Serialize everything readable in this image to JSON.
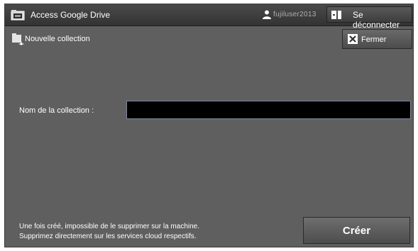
{
  "header": {
    "title": "Access Google Drive",
    "user_name": "fujiluser2013",
    "logout_label": "Se déconnecter"
  },
  "subheader": {
    "title": "Nouvelle collection",
    "close_label": "Fermer"
  },
  "form": {
    "name_label": "Nom de la collection :",
    "name_value": ""
  },
  "footer": {
    "note_line1": "Une fois créé, impossible de le supprimer sur la machine.",
    "note_line2": "Supprimez directement sur les services cloud respectifs.",
    "create_label": "Créer"
  },
  "icons": {
    "app": "folder-computer-icon",
    "user": "user-icon",
    "logout": "logout-icon",
    "collection": "new-folder-icon",
    "close": "close-icon"
  }
}
